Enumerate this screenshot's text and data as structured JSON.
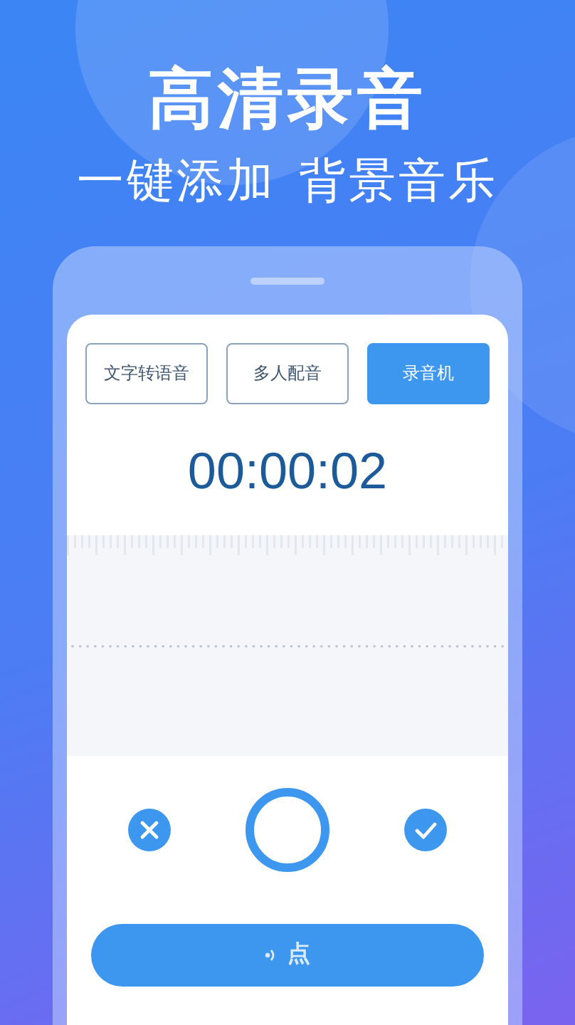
{
  "headline": "高清录音",
  "subheadline": [
    "一键添加",
    "背景音乐"
  ],
  "tabs": [
    {
      "label": "文字转语音",
      "selected": false
    },
    {
      "label": "多人配音",
      "selected": false
    },
    {
      "label": "录音机",
      "selected": true
    }
  ],
  "timer": "00:00:02",
  "bottom_button": {
    "label": "点"
  }
}
